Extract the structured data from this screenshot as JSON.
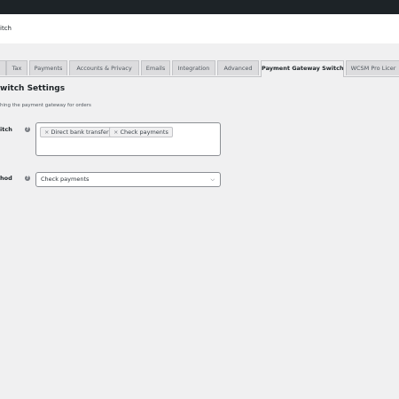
{
  "header": {
    "title": "itch"
  },
  "tabs": [
    {
      "label": "Tax"
    },
    {
      "label": "Payments"
    },
    {
      "label": "Accounts & Privacy"
    },
    {
      "label": "Emails"
    },
    {
      "label": "Integration"
    },
    {
      "label": "Advanced"
    },
    {
      "label": "Payment Gateway Switch",
      "active": true
    },
    {
      "label": "WCSM Pro Licer"
    }
  ],
  "settings": {
    "section_title": "witch Settings",
    "section_desc": "hing the payment gateway for orders",
    "gateway_switch": {
      "label": "itch",
      "selected": [
        {
          "label": "Direct bank transfer"
        },
        {
          "label": "Check payments"
        }
      ]
    },
    "method": {
      "label": "hod",
      "value": "Check payments"
    }
  }
}
